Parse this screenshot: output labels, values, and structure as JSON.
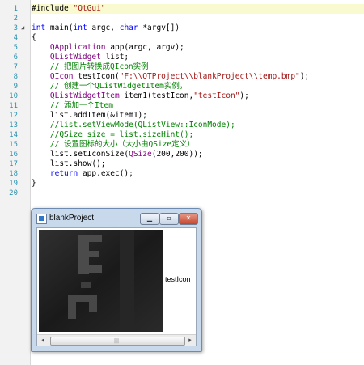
{
  "editor": {
    "lines": [
      {
        "n": "1",
        "segs": [
          {
            "c": "plain",
            "t": "#include "
          },
          {
            "c": "str",
            "t": "\"QtGui\""
          }
        ]
      },
      {
        "n": "2",
        "segs": []
      },
      {
        "n": "3",
        "fold": "◢",
        "segs": [
          {
            "c": "kw",
            "t": "int"
          },
          {
            "c": "plain",
            "t": " main("
          },
          {
            "c": "kw",
            "t": "int"
          },
          {
            "c": "plain",
            "t": " argc, "
          },
          {
            "c": "kw",
            "t": "char"
          },
          {
            "c": "plain",
            "t": " *argv[])"
          }
        ]
      },
      {
        "n": "4",
        "segs": [
          {
            "c": "plain",
            "t": "{"
          }
        ]
      },
      {
        "n": "5",
        "segs": [
          {
            "c": "plain",
            "t": "    "
          },
          {
            "c": "ty",
            "t": "QApplication"
          },
          {
            "c": "plain",
            "t": " app(argc, argv);"
          }
        ]
      },
      {
        "n": "6",
        "segs": [
          {
            "c": "plain",
            "t": "    "
          },
          {
            "c": "ty",
            "t": "QListWidget"
          },
          {
            "c": "plain",
            "t": " list;"
          }
        ]
      },
      {
        "n": "7",
        "segs": [
          {
            "c": "cm",
            "t": "    // 把图片转换成QIcon实例"
          }
        ]
      },
      {
        "n": "8",
        "segs": [
          {
            "c": "plain",
            "t": "    "
          },
          {
            "c": "ty",
            "t": "QIcon"
          },
          {
            "c": "plain",
            "t": " testIcon("
          },
          {
            "c": "str",
            "t": "\"F:\\\\QTProject\\\\blankProject\\\\temp.bmp\""
          },
          {
            "c": "plain",
            "t": ");"
          }
        ]
      },
      {
        "n": "9",
        "segs": [
          {
            "c": "cm",
            "t": "    // 创建一个QListWidgetItem实例，"
          }
        ]
      },
      {
        "n": "10",
        "segs": [
          {
            "c": "plain",
            "t": "    "
          },
          {
            "c": "ty",
            "t": "QListWidgetItem"
          },
          {
            "c": "plain",
            "t": " item1(testIcon,"
          },
          {
            "c": "str",
            "t": "\"testIcon\""
          },
          {
            "c": "plain",
            "t": ");"
          }
        ]
      },
      {
        "n": "11",
        "segs": [
          {
            "c": "cm",
            "t": "    // 添加一个Item"
          }
        ]
      },
      {
        "n": "12",
        "segs": [
          {
            "c": "plain",
            "t": "    list.addItem(&item1);"
          }
        ]
      },
      {
        "n": "13",
        "segs": [
          {
            "c": "cm",
            "t": "    //list.setViewMode(QListView::IconMode);"
          }
        ]
      },
      {
        "n": "14",
        "segs": [
          {
            "c": "cm",
            "t": "    //QSize size = list.sizeHint();"
          }
        ]
      },
      {
        "n": "15",
        "segs": [
          {
            "c": "cm",
            "t": "    // 设置图标的大小（大小由QSize定义）"
          }
        ]
      },
      {
        "n": "16",
        "segs": [
          {
            "c": "plain",
            "t": "    list.setIconSize("
          },
          {
            "c": "ty",
            "t": "QSize"
          },
          {
            "c": "plain",
            "t": "(200,200));"
          }
        ]
      },
      {
        "n": "17",
        "segs": [
          {
            "c": "plain",
            "t": "    list.show();"
          }
        ]
      },
      {
        "n": "18",
        "segs": [
          {
            "c": "plain",
            "t": "    "
          },
          {
            "c": "kw",
            "t": "return"
          },
          {
            "c": "plain",
            "t": " app.exec();"
          }
        ]
      },
      {
        "n": "19",
        "segs": [
          {
            "c": "plain",
            "t": "}"
          }
        ]
      },
      {
        "n": "20",
        "segs": []
      }
    ]
  },
  "window": {
    "title": "blankProject",
    "minimize_glyph": "▁",
    "maximize_glyph": "▫",
    "close_glyph": "✕",
    "item_label": "testIcon",
    "scroll_left": "◂",
    "scroll_right": "▸",
    "scroll_grip": "|||"
  },
  "colors": {
    "keyword": "#0000ff",
    "string": "#a31515",
    "comment": "#008000",
    "type": "#800080",
    "line_number": "#2b91af"
  }
}
